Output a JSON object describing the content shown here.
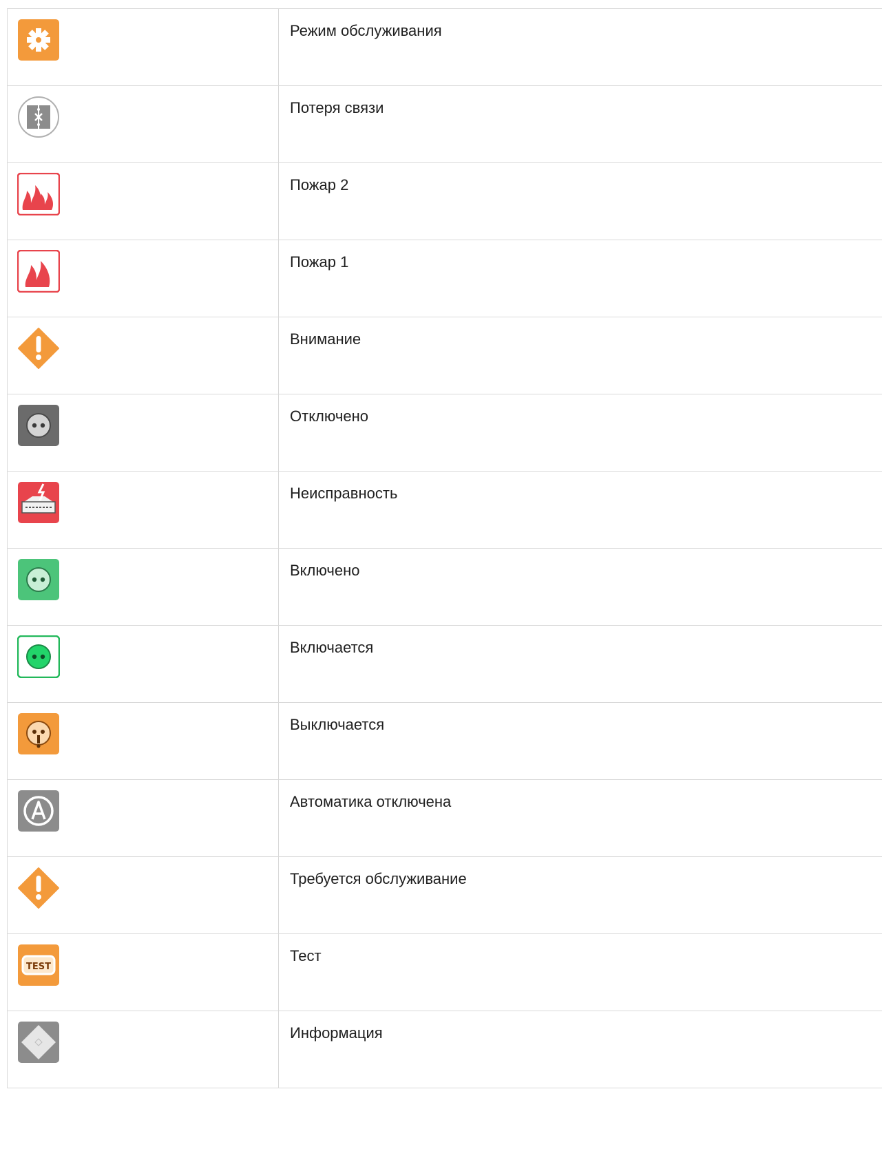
{
  "rows": [
    {
      "icon": "gear-icon",
      "label": "Режим обслуживания"
    },
    {
      "icon": "connection-lost-icon",
      "label": "Потеря связи"
    },
    {
      "icon": "fire2-icon",
      "label": "Пожар 2"
    },
    {
      "icon": "fire1-icon",
      "label": "Пожар 1"
    },
    {
      "icon": "warning-diamond-icon",
      "label": "Внимание"
    },
    {
      "icon": "socket-off-icon",
      "label": "Отключено"
    },
    {
      "icon": "fault-icon",
      "label": "Неисправность"
    },
    {
      "icon": "socket-on-icon",
      "label": "Включено"
    },
    {
      "icon": "socket-turning-on-icon",
      "label": "Включается"
    },
    {
      "icon": "socket-turning-off-icon",
      "label": "Выключается"
    },
    {
      "icon": "automation-off-icon",
      "label": "Автоматика отключена"
    },
    {
      "icon": "maintenance-required-icon",
      "label": "Требуется обслуживание"
    },
    {
      "icon": "test-icon",
      "label": "Тест"
    },
    {
      "icon": "info-icon",
      "label": "Информация"
    }
  ],
  "icon_texts": {
    "test": "TEST"
  },
  "colors": {
    "orange": "#f39a3b",
    "red": "#e8444c",
    "gray": "#8c8c8c",
    "dark_gray": "#6b6b6b",
    "green": "#4cc47a",
    "bright_green": "#22d46a",
    "border": "#d9d9d9"
  }
}
